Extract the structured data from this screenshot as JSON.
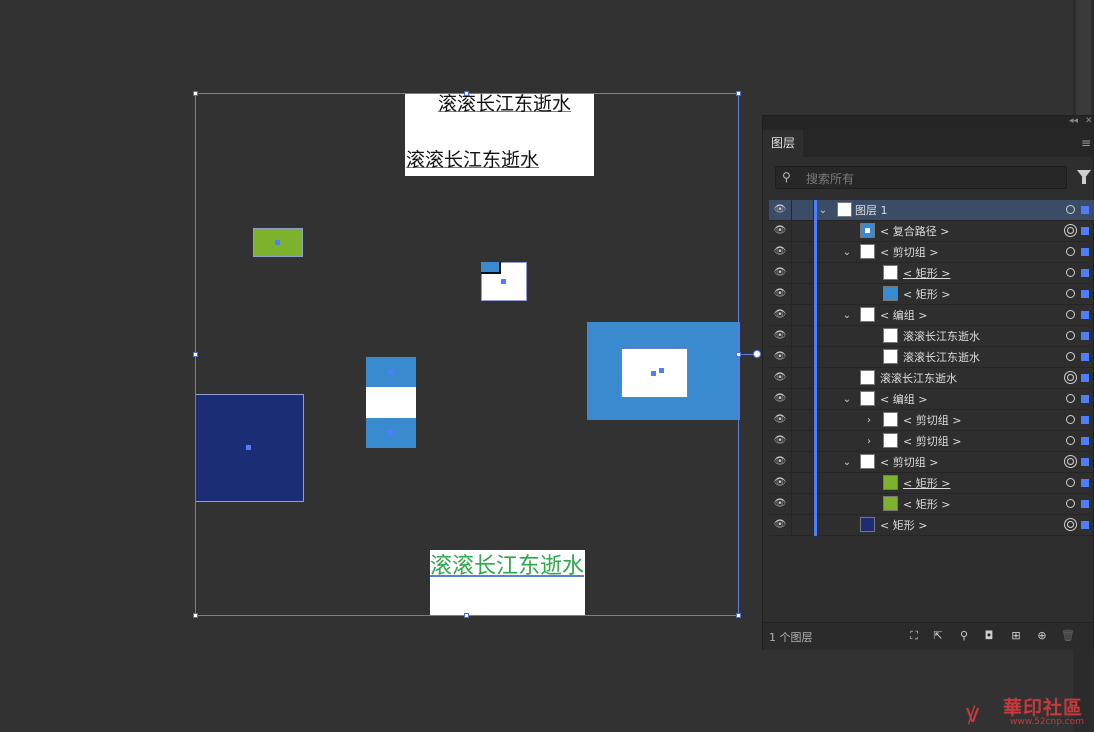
{
  "canvas": {
    "text_top_1": "滚滚长江东逝水",
    "text_top_2": "滚滚长江东逝水",
    "text_bottom_green": "滚滚长江东逝水",
    "colors": {
      "background": "#323232",
      "green": "#7db32c",
      "light_blue": "#3a8ad0",
      "navy": "#1b2d74",
      "selection": "#5b7fe0",
      "green_text": "#2fa84a"
    }
  },
  "layers_panel": {
    "tab_label": "图层",
    "search_placeholder": "搜索所有",
    "rows": [
      {
        "label": "图层 1",
        "thumb": "layer"
      },
      {
        "label": "< 复合路径 >",
        "thumb": "blue-white"
      },
      {
        "label": "< 剪切组 >",
        "thumb": "white-dot"
      },
      {
        "label": "< 矩形 >",
        "thumb": "white"
      },
      {
        "label": "< 矩形 >",
        "thumb": "blue"
      },
      {
        "label": "< 编组 >",
        "thumb": "text"
      },
      {
        "label": "滚滚长江东逝水",
        "thumb": "text"
      },
      {
        "label": "滚滚长江东逝水",
        "thumb": "text"
      },
      {
        "label": "滚滚长江东逝水",
        "thumb": "green-text"
      },
      {
        "label": "< 编组 >",
        "thumb": "stack"
      },
      {
        "label": "< 剪切组 >",
        "thumb": "white-dot"
      },
      {
        "label": "< 剪切组 >",
        "thumb": "white-dot"
      },
      {
        "label": "< 剪切组 >",
        "thumb": "green-dot"
      },
      {
        "label": "< 矩形 >",
        "thumb": "green"
      },
      {
        "label": "< 矩形 >",
        "thumb": "green"
      },
      {
        "label": "< 矩形 >",
        "thumb": "navy"
      }
    ],
    "footer_count": "1 个图层"
  },
  "watermark": {
    "text": "華印社區",
    "url": "www.52cnp.com"
  }
}
